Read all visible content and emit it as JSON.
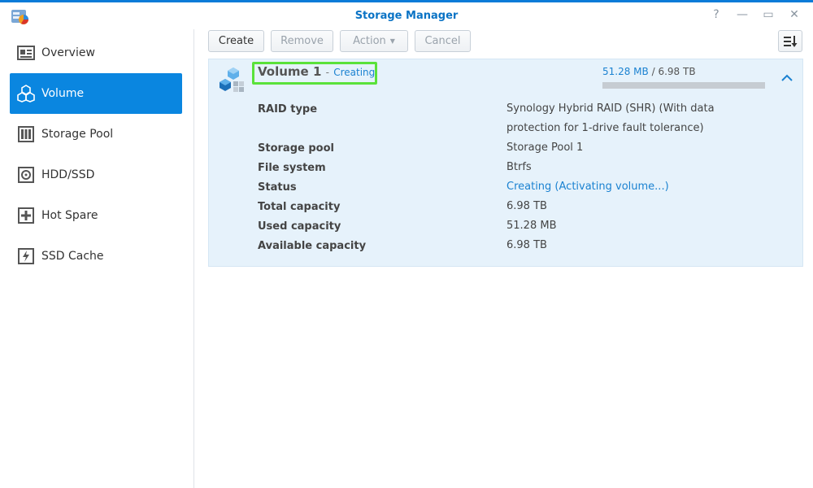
{
  "window": {
    "title": "Storage Manager",
    "controls": [
      {
        "name": "help",
        "glyph": "?"
      },
      {
        "name": "minimize",
        "glyph": "—"
      },
      {
        "name": "maximize",
        "glyph": "▭"
      },
      {
        "name": "close",
        "glyph": "✕"
      }
    ]
  },
  "sidebar": {
    "items": [
      {
        "label": "Overview",
        "icon": "overview-icon"
      },
      {
        "label": "Volume",
        "icon": "volume-icon",
        "active": true
      },
      {
        "label": "Storage Pool",
        "icon": "storage-pool-icon"
      },
      {
        "label": "HDD/SSD",
        "icon": "hdd-icon"
      },
      {
        "label": "Hot Spare",
        "icon": "hot-spare-icon"
      },
      {
        "label": "SSD Cache",
        "icon": "ssd-cache-icon"
      }
    ]
  },
  "toolbar": {
    "create_label": "Create",
    "remove_label": "Remove",
    "action_label": "Action",
    "cancel_label": "Cancel"
  },
  "volume": {
    "name": "Volume 1",
    "dash": "-",
    "status": "Creating",
    "used": "51.28 MB",
    "separator": "/",
    "total": "6.98 TB",
    "usage_fraction": 0.0,
    "details": [
      {
        "label": "RAID type",
        "value": "Synology Hybrid RAID (SHR) (With data protection for 1-drive fault tolerance)"
      },
      {
        "label": "Storage pool",
        "value": "Storage Pool 1"
      },
      {
        "label": "File system",
        "value": "Btrfs"
      },
      {
        "label": "Status",
        "value": "Creating (Activating volume...)"
      },
      {
        "label": "Total capacity",
        "value": "6.98 TB"
      },
      {
        "label": "Used capacity",
        "value": "51.28 MB"
      },
      {
        "label": "Available capacity",
        "value": "6.98 TB"
      }
    ]
  },
  "colors": {
    "accent": "#0a86e0",
    "link": "#1b82d1",
    "highlight": "#5ae23a",
    "panel_bg": "#e6f2fb"
  }
}
